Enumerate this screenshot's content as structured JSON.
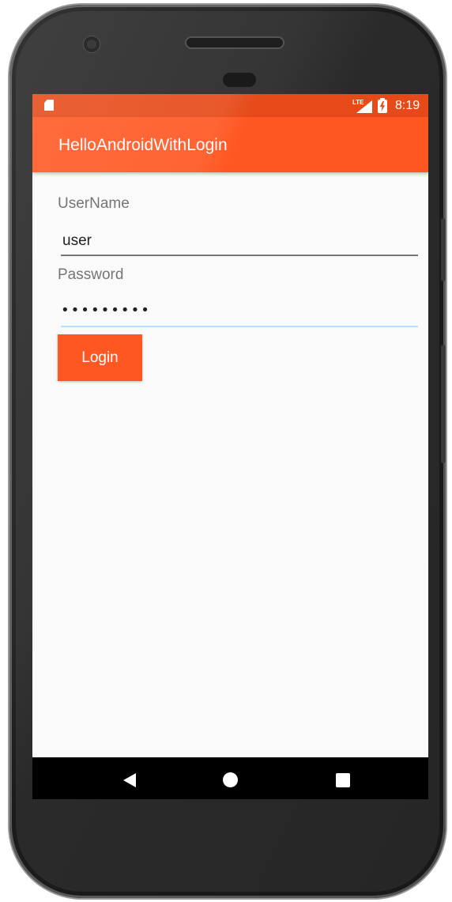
{
  "status_bar": {
    "network": "LTE",
    "time": "8:19",
    "icons": [
      "sd-card-icon",
      "lte-signal-icon",
      "battery-charging-icon"
    ]
  },
  "app_bar": {
    "title": "HelloAndroidWithLogin"
  },
  "form": {
    "username_label": "UserName",
    "username_value": "user",
    "password_label": "Password",
    "password_masked": "•••••••••",
    "login_label": "Login"
  },
  "nav_bar": {
    "icons": [
      "back-icon",
      "home-icon",
      "recents-icon"
    ]
  },
  "colors": {
    "primary": "#ff5722",
    "primary_dark": "#e64a19",
    "background": "#fafafa",
    "focused_underline": "#bbdefb",
    "underline": "#757575"
  }
}
